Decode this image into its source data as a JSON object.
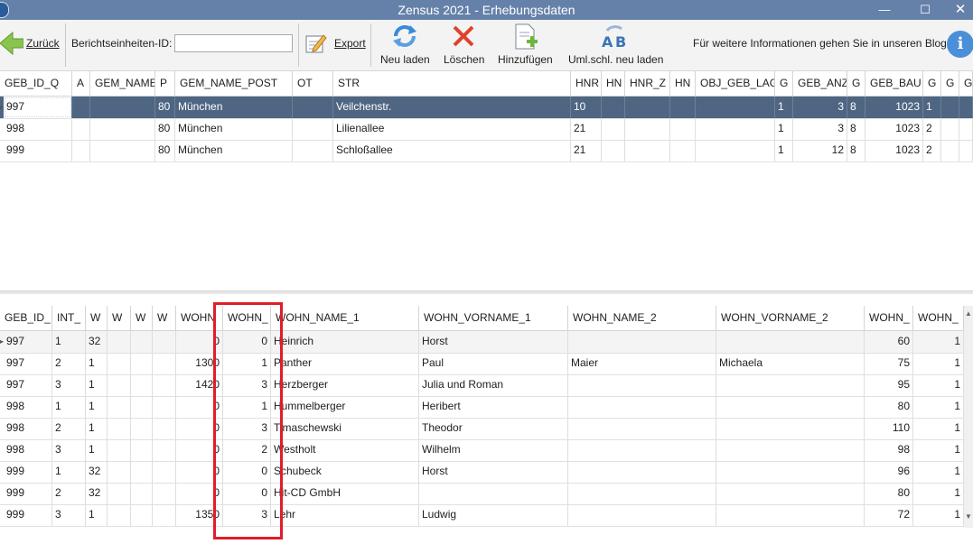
{
  "window": {
    "title": "Zensus 2021 - Erhebungsdaten",
    "controls": {
      "minimize": "—",
      "maximize": "☐",
      "close": "✕"
    }
  },
  "toolbar": {
    "back_label": "Zurück",
    "id_label": "Berichtseinheiten-ID:",
    "id_value": "",
    "export_label": "Export",
    "reload_label": "Neu laden",
    "delete_label": "Löschen",
    "add_label": "Hinzufügen",
    "umlaut_reload_label": "Uml.schl. neu laden",
    "info_text": "Für weitere Informationen gehen Sie in unseren Blog",
    "colors": {
      "back_arrow": "#7cbf45",
      "delete": "#e0412f",
      "reload": "#3a8ad6",
      "info": "#4a90d9"
    }
  },
  "top_grid": {
    "headers": [
      "GEB_ID_Q",
      "A",
      "GEM_NAME",
      "P",
      "GEM_NAME_POST",
      "OT",
      "STR",
      "HNR",
      "HN",
      "HNR_Z",
      "HN",
      "OBJ_GEB_LAGE",
      "G",
      "GEB_ANZ",
      "G",
      "GEB_BAU",
      "G",
      "G",
      "G"
    ],
    "rows": [
      [
        "997",
        "",
        "",
        "80",
        "München",
        "",
        "Veilchenstr.",
        "10",
        "",
        "",
        "",
        "",
        "1",
        "3",
        "8",
        "1023",
        "1",
        "",
        ""
      ],
      [
        "998",
        "",
        "",
        "80",
        "München",
        "",
        "Lilienallee",
        "21",
        "",
        "",
        "",
        "",
        "1",
        "3",
        "8",
        "1023",
        "2",
        "",
        ""
      ],
      [
        "999",
        "",
        "",
        "80",
        "München",
        "",
        "Schloßallee",
        "21",
        "",
        "",
        "",
        "",
        "1",
        "12",
        "8",
        "1023",
        "2",
        "",
        ""
      ]
    ]
  },
  "bottom_grid": {
    "headers": [
      "GEB_ID_",
      "INT_",
      "W",
      "W",
      "W",
      "W",
      "WOHN",
      "WOHN_",
      "WOHN_NAME_1",
      "WOHN_VORNAME_1",
      "WOHN_NAME_2",
      "WOHN_VORNAME_2",
      "WOHN_",
      "WOHN_"
    ],
    "rows": [
      [
        "997",
        "1",
        "32",
        "",
        "",
        "",
        "0",
        "0",
        "Heinrich",
        "Horst",
        "",
        "",
        "60",
        "1"
      ],
      [
        "997",
        "2",
        "1",
        "",
        "",
        "",
        "1300",
        "1",
        "Panther",
        "Paul",
        "Maier",
        "Michaela",
        "75",
        "1"
      ],
      [
        "997",
        "3",
        "1",
        "",
        "",
        "",
        "1420",
        "3",
        "Herzberger",
        "Julia und  Roman",
        "",
        "",
        "95",
        "1"
      ],
      [
        "998",
        "1",
        "1",
        "",
        "",
        "",
        "0",
        "1",
        "Hummelberger",
        "Heribert",
        "",
        "",
        "80",
        "1"
      ],
      [
        "998",
        "2",
        "1",
        "",
        "",
        "",
        "0",
        "3",
        "Timaschewski",
        "Theodor",
        "",
        "",
        "110",
        "1"
      ],
      [
        "998",
        "3",
        "1",
        "",
        "",
        "",
        "0",
        "2",
        "Westholt",
        "Wilhelm",
        "",
        "",
        "98",
        "1"
      ],
      [
        "999",
        "1",
        "32",
        "",
        "",
        "",
        "0",
        "0",
        "Schubeck",
        "Horst",
        "",
        "",
        "96",
        "1"
      ],
      [
        "999",
        "2",
        "32",
        "",
        "",
        "",
        "0",
        "0",
        "Hit-CD GmbH",
        "",
        "",
        "",
        "80",
        "1"
      ],
      [
        "999",
        "3",
        "1",
        "",
        "",
        "",
        "1350",
        "3",
        "Lehr",
        "Ludwig",
        "",
        "",
        "72",
        "1"
      ]
    ],
    "highlight_color": "#e11d2a"
  }
}
